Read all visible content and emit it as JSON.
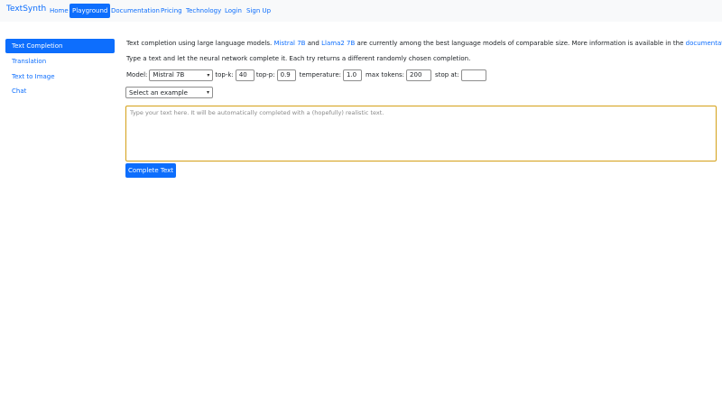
{
  "brand": "TextSynth",
  "nav": {
    "items": [
      "Home",
      "Playground",
      "Documentation",
      "Pricing",
      "Technology",
      "Login",
      "Sign Up"
    ]
  },
  "sidebar": {
    "items": [
      "Text Completion",
      "Translation",
      "Text to Image",
      "Chat"
    ]
  },
  "intro": {
    "prefix": "Text completion using large language models.",
    "link1": "Mistral 7B",
    "and": "and",
    "link2": "Llama2 7B",
    "middle": "are currently among the best language models of comparable size. More information is available in the",
    "link3": "documentation",
    "suffix": "."
  },
  "instructions": "Type a text and let the neural network complete it. Each try returns a different randomly chosen completion.",
  "controls": {
    "model_label": "Model:",
    "model_value": "Mistral 7B",
    "topk_label": "top-k:",
    "topk_value": "40",
    "topp_label": "top-p:",
    "topp_value": "0.9",
    "temp_label": "temperature:",
    "temp_value": "1.0",
    "maxtok_label": "max tokens:",
    "maxtok_value": "200",
    "stop_label": "stop at:",
    "stop_value": ""
  },
  "example_select": "Select an example",
  "textarea_placeholder": "Type your text here. It will be automatically completed with a (hopefully) realistic text.",
  "submit_label": "Complete Text",
  "active_nav": "Playground",
  "active_sidebar": "Text Completion",
  "colors": {
    "accent": "#0d6efd",
    "navbar_bg": "#f8f9fa",
    "textarea_focus": "#d4a017"
  }
}
